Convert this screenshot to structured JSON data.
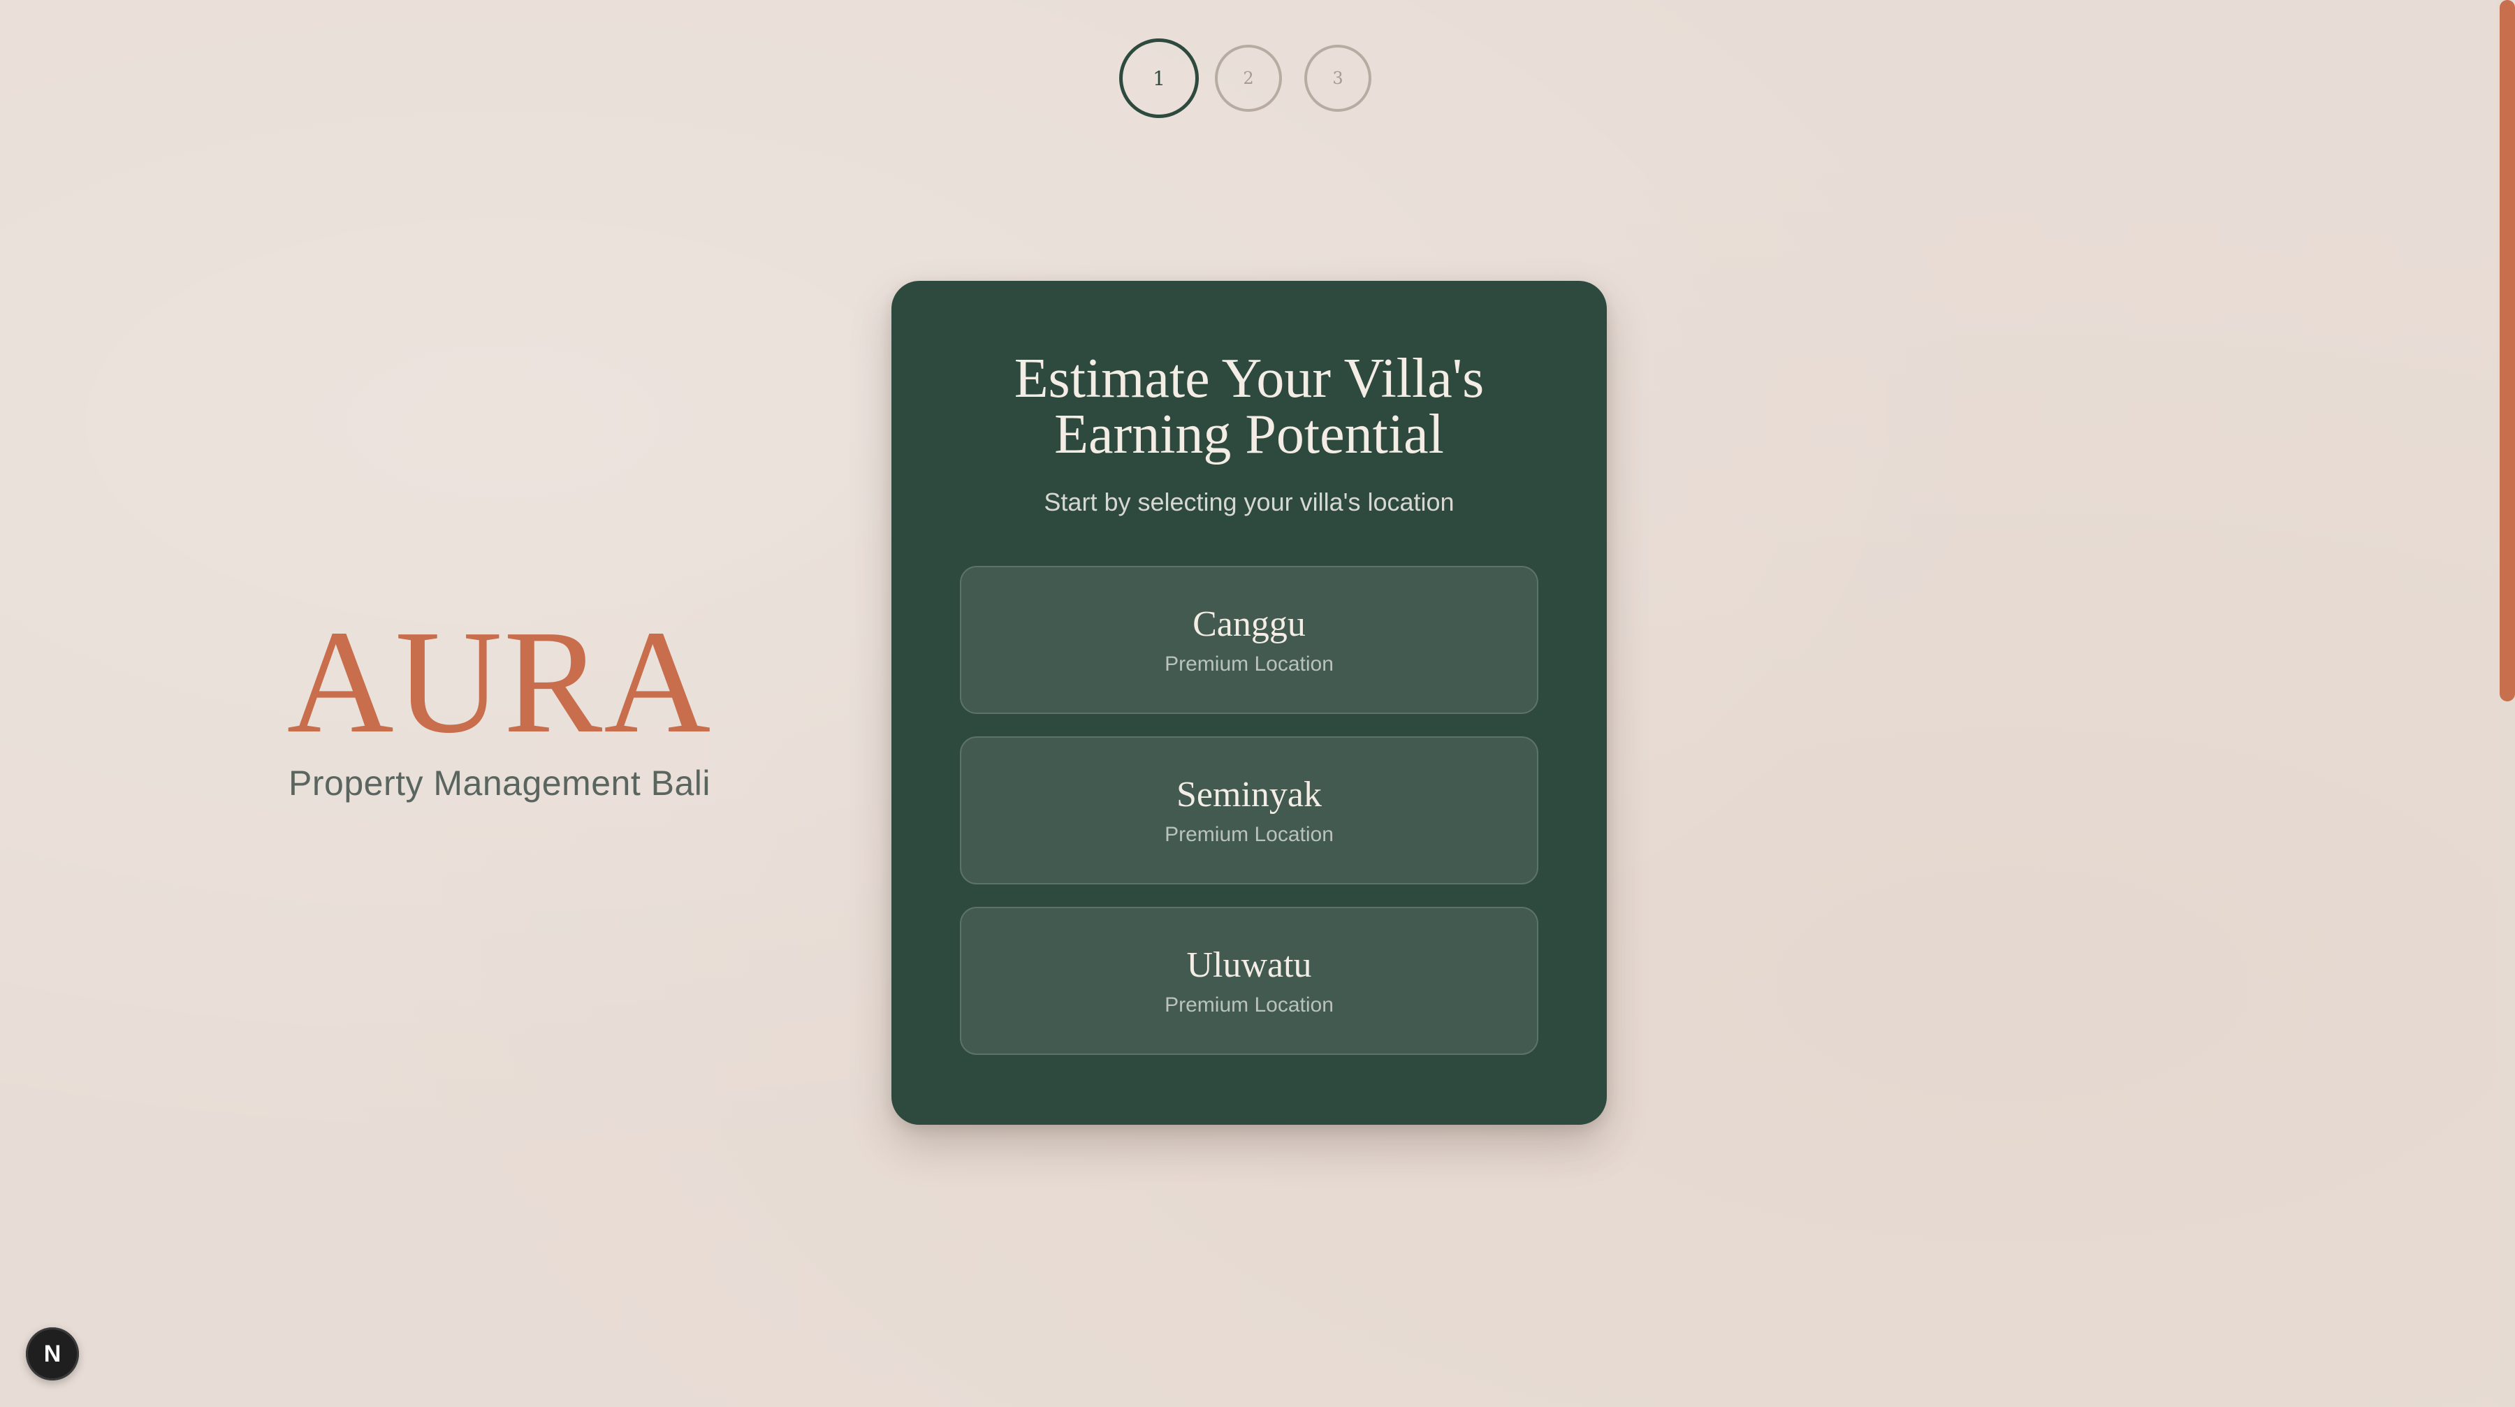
{
  "stepper": {
    "steps": [
      "1",
      "2",
      "3"
    ],
    "active_step": 1
  },
  "brand": {
    "logo": "AURA",
    "tagline": "Property Management Bali"
  },
  "card": {
    "title_line1": "Estimate Your Villa's",
    "title_line2": "Earning Potential",
    "subtitle": "Start by selecting your villa's location",
    "options": [
      {
        "name": "Canggu",
        "tag": "Premium Location"
      },
      {
        "name": "Seminyak",
        "tag": "Premium Location"
      },
      {
        "name": "Uluwatu",
        "tag": "Premium Location"
      }
    ]
  },
  "dev_badge": {
    "letter": "N"
  },
  "colors": {
    "background": "#e8ddd6",
    "card": "#2e4a3e",
    "accent": "#c96e4c",
    "option": "#435a50"
  }
}
